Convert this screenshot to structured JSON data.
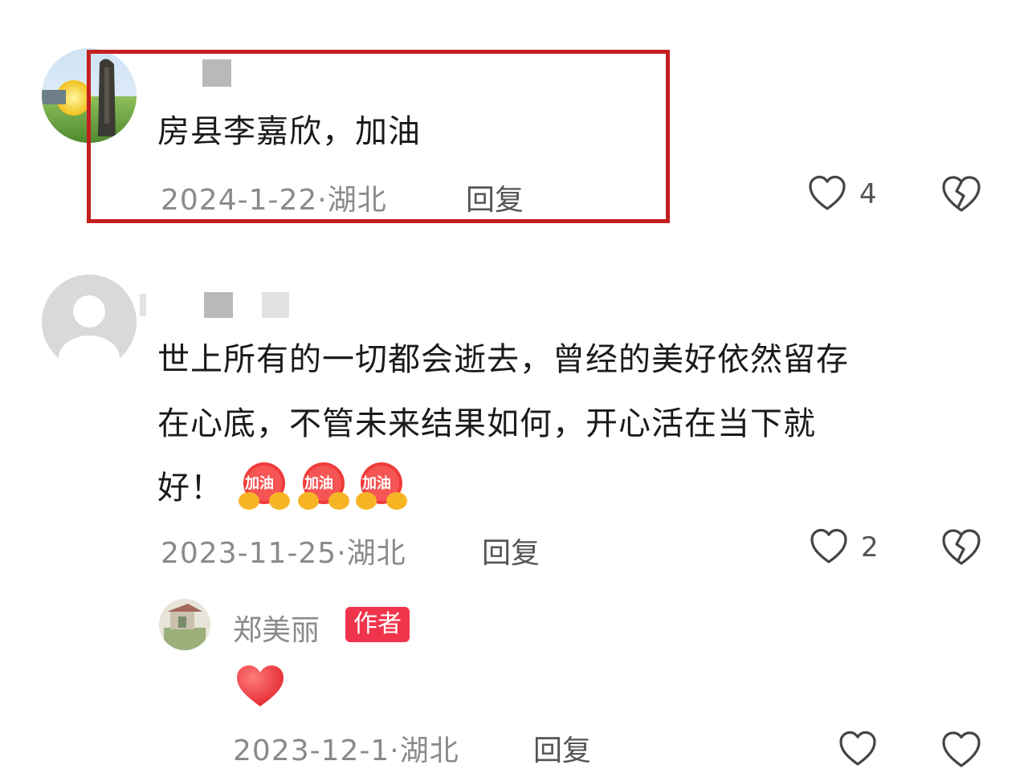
{
  "comments": [
    {
      "text": "房县李嘉欣，加油",
      "date_location": "2024-1-22·湖北",
      "reply_label": "回复",
      "like_count": "4",
      "highlight_color": "#c41f1f"
    },
    {
      "text_lines": [
        "世上所有的一切都会逝去，曾经的美好依然留存",
        "在心底，不管未来结果如何，开心活在当下就",
        "好！"
      ],
      "sticker_label": "加油",
      "date_location": "2023-11-25·湖北",
      "reply_label": "回复",
      "like_count": "2",
      "reply": {
        "author": "郑美丽",
        "badge": "作者",
        "badge_color": "#f0344c"
      }
    }
  ],
  "partial_bottom": {
    "date_location": "2023-12-1·湖北",
    "reply_label": "回复"
  }
}
